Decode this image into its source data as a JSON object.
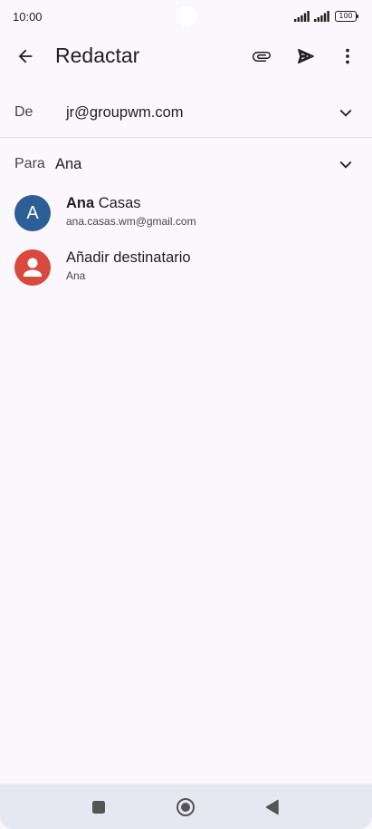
{
  "status_bar": {
    "time": "10:00",
    "battery": "100",
    "icons": [
      "signal-icon",
      "signal-icon",
      "battery-icon"
    ]
  },
  "app_bar": {
    "title": "Redactar",
    "icons": [
      "back-arrow-icon",
      "attach-icon",
      "send-icon",
      "more-vert-icon"
    ]
  },
  "compose": {
    "from_label": "De",
    "from_value": "jr@groupwm.com",
    "to_label": "Para",
    "to_value": "Ana"
  },
  "suggestions": [
    {
      "name_bold": "Ana",
      "name_rest": " Casas",
      "subtitle": "ana.casas.wm@gmail.com",
      "avatar_letter": "A",
      "avatar_color": "#2d5f96"
    },
    {
      "name_bold": "",
      "name_rest": "Añadir destinatario",
      "subtitle": "Ana",
      "avatar_letter": "",
      "avatar_color": "#d9493d"
    }
  ],
  "nav_bar": {
    "icons": [
      "recents-square-icon",
      "home-circle-icon",
      "back-triangle-icon"
    ]
  },
  "colors": {
    "background": "#fbf8fd",
    "text": "#1f1f1f",
    "secondary_text": "#444746"
  }
}
